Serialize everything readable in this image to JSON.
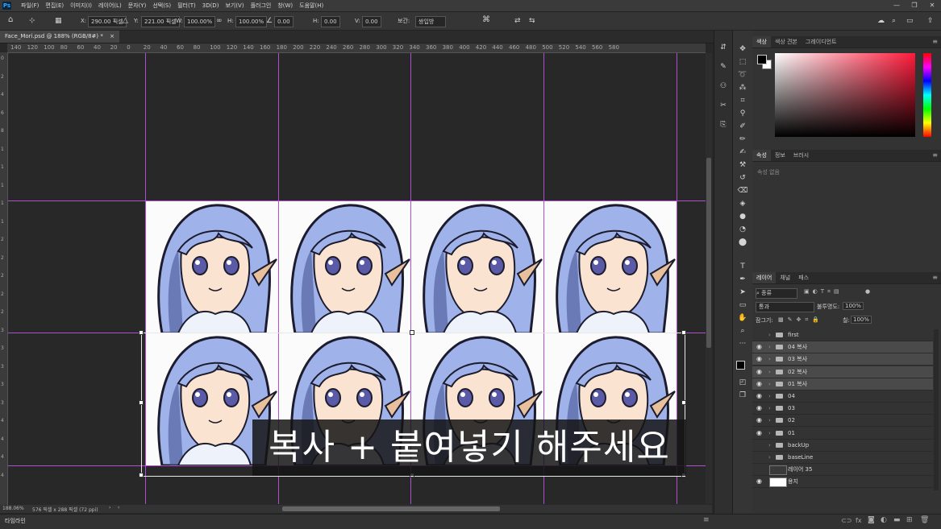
{
  "menu": {
    "app_icon": "Ps",
    "items": [
      "파일(F)",
      "편집(E)",
      "이미지(I)",
      "레이어(L)",
      "문자(Y)",
      "선택(S)",
      "필터(T)",
      "3D(D)",
      "보기(V)",
      "플러그인",
      "창(W)",
      "도움말(H)"
    ],
    "window_controls": [
      "—",
      "❐",
      "✕"
    ]
  },
  "options": {
    "x_label": "X:",
    "x_value": "290.00 픽셀",
    "y_label": "Y:",
    "y_value": "221.00 픽셀",
    "w_label": "W:",
    "w_value": "100.00%",
    "h_label": "H:",
    "h_value": "100.00%",
    "angle_value": "0.00",
    "hskew_label": "H:",
    "hskew_value": "0.00",
    "vskew_label": "V:",
    "vskew_value": "0.00",
    "interp_label": "보간:",
    "interp_value": "쌍입방"
  },
  "document": {
    "tab_title": "Face_Mori.psd @ 188% (RGB/8#) *",
    "tab_close": "×"
  },
  "rulers": {
    "h_ticks": [
      "140",
      "120",
      "100",
      "80",
      "60",
      "40",
      "20",
      "0",
      "20",
      "40",
      "60",
      "80",
      "100",
      "120",
      "140",
      "160",
      "180",
      "200",
      "220",
      "240",
      "260",
      "280",
      "300",
      "320",
      "340",
      "360",
      "380",
      "400",
      "420",
      "440",
      "460",
      "480",
      "500",
      "520",
      "540",
      "560",
      "580"
    ],
    "v_ticks": [
      "0",
      "2",
      "4",
      "6",
      "8",
      "1",
      "1",
      "1",
      "1",
      "1",
      "2",
      "2",
      "2",
      "2",
      "2",
      "3",
      "3",
      "3",
      "3",
      "3",
      "4",
      "4",
      "4",
      "4"
    ]
  },
  "canvas": {
    "subtitle": "복사 + 붙여넣기 해주세요",
    "sprite_columns": 4,
    "sprite_rows": 2,
    "colors": {
      "hair": "#9fb3ea",
      "hair_dark": "#3d4a8a",
      "skin": "#fbe3d2",
      "ear": "#e8c09c",
      "collar": "#eef2fb",
      "eye": "#5b5aa6",
      "outline": "#1c1c2e"
    }
  },
  "status": {
    "zoom": "188.06%",
    "doc_size": "576 픽셀 x 288 픽셀 (72 ppi)",
    "arrow": "›",
    "left_arrow": "‹",
    "timeline_label": "타임라인"
  },
  "panels": {
    "color_tabs": [
      "색상",
      "색상 견본",
      "그레이디언트"
    ],
    "props_tabs": [
      "속성",
      "정보",
      "브러시"
    ],
    "props_empty": "속성 없음",
    "layers_tabs": [
      "레이어",
      "채널",
      "패스"
    ],
    "filter_kind": "종류",
    "blend_mode": "통과",
    "opacity_label": "불투명도:",
    "opacity_value": "100%",
    "lock_label": "잠그기:",
    "fill_label": "칠:",
    "fill_value": "100%",
    "layers": [
      {
        "name": "first",
        "type": "group",
        "visible": false,
        "highlight": false
      },
      {
        "name": "04 복사",
        "type": "group",
        "visible": true,
        "highlight": true
      },
      {
        "name": "03 복사",
        "type": "group",
        "visible": true,
        "highlight": true
      },
      {
        "name": "02 복사",
        "type": "group",
        "visible": true,
        "highlight": true
      },
      {
        "name": "01 복사",
        "type": "group",
        "visible": true,
        "highlight": true
      },
      {
        "name": "04",
        "type": "group",
        "visible": true,
        "highlight": false
      },
      {
        "name": "03",
        "type": "group",
        "visible": true,
        "highlight": false
      },
      {
        "name": "02",
        "type": "group",
        "visible": true,
        "highlight": false
      },
      {
        "name": "01",
        "type": "group",
        "visible": true,
        "highlight": false
      },
      {
        "name": "backUp",
        "type": "group",
        "visible": false,
        "highlight": false
      },
      {
        "name": "baseLine",
        "type": "group",
        "visible": false,
        "highlight": false
      },
      {
        "name": "레이어 35",
        "type": "layer-empty",
        "visible": false,
        "highlight": false
      },
      {
        "name": "용지",
        "type": "layer-white",
        "visible": true,
        "highlight": false
      }
    ]
  }
}
